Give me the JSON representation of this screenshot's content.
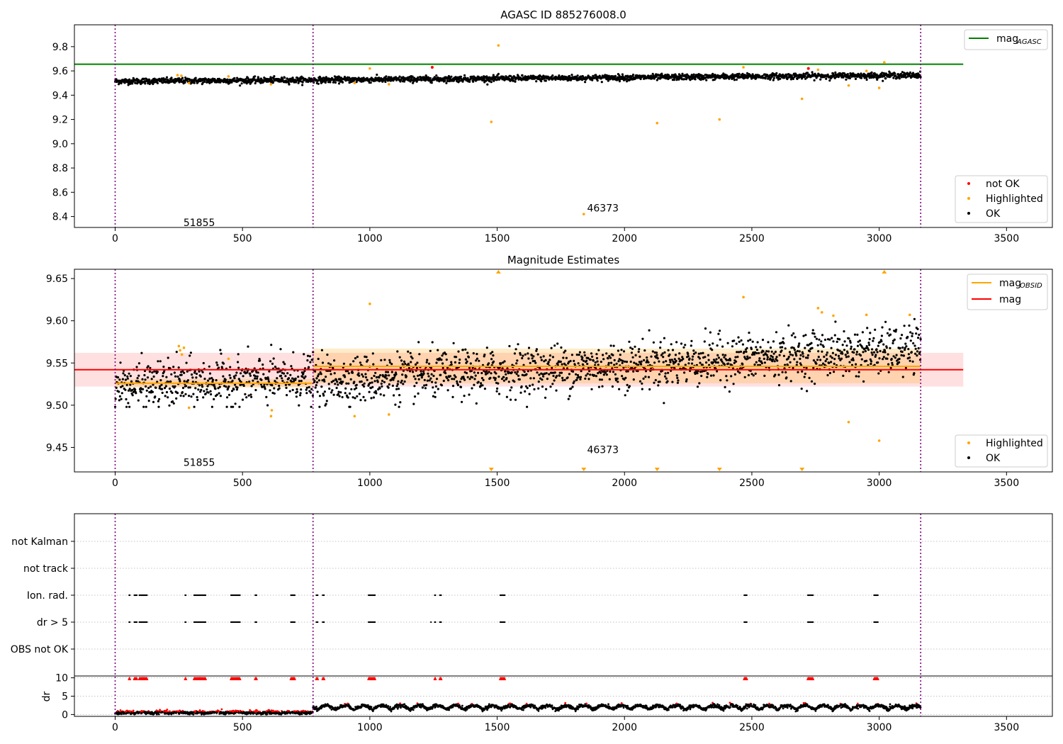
{
  "chart_data": [
    {
      "type": "scatter",
      "title": "AGASC ID 885276008.0",
      "xlabel": "",
      "ylabel": "",
      "xlim": [
        -160,
        3680
      ],
      "ylim": [
        8.31,
        9.98
      ],
      "xticks": [
        "0",
        "500",
        "1000",
        "1500",
        "2000",
        "2500",
        "3000",
        "3500"
      ],
      "yticks": [
        "8.4",
        "8.6",
        "8.8",
        "9.0",
        "9.2",
        "9.4",
        "9.6",
        "9.8"
      ],
      "vlines": [
        0,
        777,
        3163
      ],
      "annotations": [
        {
          "text": "51855",
          "x": 385,
          "y": 8.35
        },
        {
          "text": "46373",
          "x": 1970,
          "y": 8.47
        }
      ],
      "hlines": [
        {
          "name": "mag_AGASC",
          "y": 9.655,
          "x": [
            -160,
            3330
          ],
          "color": "#008000"
        }
      ],
      "ok_band": {
        "x0": 0,
        "x1": 3163,
        "segments": [
          {
            "x0": 0,
            "x1": 777,
            "m0": 9.515,
            "m1": 9.525
          },
          {
            "x0": 777,
            "x1": 3163,
            "m0": 9.525,
            "m1": 9.565
          }
        ],
        "scatter": 0.012
      },
      "highlighted": [
        {
          "x": 245,
          "y": 9.565
        },
        {
          "x": 260,
          "y": 9.56
        },
        {
          "x": 290,
          "y": 9.5
        },
        {
          "x": 445,
          "y": 9.555
        },
        {
          "x": 612,
          "y": 9.49
        },
        {
          "x": 940,
          "y": 9.5
        },
        {
          "x": 1000,
          "y": 9.62
        },
        {
          "x": 1075,
          "y": 9.49
        },
        {
          "x": 1477,
          "y": 9.18
        },
        {
          "x": 1505,
          "y": 9.81
        },
        {
          "x": 1840,
          "y": 8.42
        },
        {
          "x": 2128,
          "y": 9.17
        },
        {
          "x": 2373,
          "y": 9.2
        },
        {
          "x": 2467,
          "y": 9.63
        },
        {
          "x": 2697,
          "y": 9.37
        },
        {
          "x": 2760,
          "y": 9.61
        },
        {
          "x": 2880,
          "y": 9.48
        },
        {
          "x": 2950,
          "y": 9.6
        },
        {
          "x": 3000,
          "y": 9.46
        },
        {
          "x": 3020,
          "y": 9.67
        }
      ],
      "not_ok": [
        {
          "x": 1245,
          "y": 9.63
        },
        {
          "x": 2722,
          "y": 9.62
        }
      ],
      "legend_top": {
        "position": "top-right",
        "entries": [
          {
            "label": "mag",
            "sub": "AGASC",
            "color": "#008000"
          }
        ]
      },
      "legend_bottom": {
        "position": "bottom-right",
        "entries": [
          {
            "label": "not OK",
            "color": "#ff0000"
          },
          {
            "label": "Highlighted",
            "color": "#ffa500"
          },
          {
            "label": "OK",
            "color": "#000000"
          }
        ]
      }
    },
    {
      "type": "scatter",
      "title": "Magnitude Estimates",
      "xlabel": "",
      "ylabel": "",
      "xlim": [
        -160,
        3680
      ],
      "ylim": [
        9.421,
        9.661
      ],
      "xticks": [
        "0",
        "500",
        "1000",
        "1500",
        "2000",
        "2500",
        "3000",
        "3500"
      ],
      "yticks": [
        "9.45",
        "9.50",
        "9.55",
        "9.60",
        "9.65"
      ],
      "vlines": [
        0,
        777,
        3163
      ],
      "annotations": [
        {
          "text": "51855",
          "x": 385,
          "y": 9.4325
        },
        {
          "text": "46373",
          "x": 1970,
          "y": 9.4475
        }
      ],
      "mag": {
        "y": 9.542,
        "band": [
          9.522,
          9.562
        ],
        "x": [
          -160,
          3330
        ],
        "color": "#ff0000"
      },
      "mag_obsid": [
        {
          "x": [
            0,
            777
          ],
          "y": 9.526,
          "band": [
            9.521,
            9.531
          ]
        },
        {
          "x": [
            777,
            3163
          ],
          "y": 9.546,
          "band": [
            9.526,
            9.567
          ]
        }
      ],
      "ok_scatter": 0.014,
      "highlighted": [
        {
          "x": 250,
          "y": 9.57
        },
        {
          "x": 255,
          "y": 9.565
        },
        {
          "x": 262,
          "y": 9.56
        },
        {
          "x": 270,
          "y": 9.568
        },
        {
          "x": 290,
          "y": 9.497
        },
        {
          "x": 445,
          "y": 9.555
        },
        {
          "x": 612,
          "y": 9.487
        },
        {
          "x": 615,
          "y": 9.494
        },
        {
          "x": 940,
          "y": 9.487
        },
        {
          "x": 1000,
          "y": 9.62
        },
        {
          "x": 1075,
          "y": 9.489
        },
        {
          "x": 2467,
          "y": 9.628
        },
        {
          "x": 2760,
          "y": 9.615
        },
        {
          "x": 2775,
          "y": 9.61
        },
        {
          "x": 2820,
          "y": 9.606
        },
        {
          "x": 2880,
          "y": 9.48
        },
        {
          "x": 2950,
          "y": 9.607
        },
        {
          "x": 3000,
          "y": 9.458
        },
        {
          "x": 3120,
          "y": 9.607
        }
      ],
      "offscale_up": [
        1505,
        3020
      ],
      "offscale_down": [
        1477,
        1840,
        2128,
        2373,
        2697
      ],
      "legend_top": {
        "position": "top-right",
        "entries": [
          {
            "label": "mag",
            "sub": "OBSID",
            "color": "#ffa500"
          },
          {
            "label": "mag",
            "sub": "",
            "color": "#ff0000"
          }
        ]
      },
      "legend_bottom": {
        "position": "bottom-right",
        "entries": [
          {
            "label": "Highlighted",
            "color": "#ffa500"
          },
          {
            "label": "OK",
            "color": "#000000"
          }
        ]
      }
    },
    {
      "type": "scatter",
      "title": "",
      "xlabel": "",
      "ylabel": "",
      "xlim": [
        -160,
        3680
      ],
      "ylim": [
        -0.5,
        5.5
      ],
      "xticks": [
        "0",
        "500",
        "1000",
        "1500",
        "2000",
        "2500",
        "3000",
        "3500"
      ],
      "flag_rows": [
        "not Kalman",
        "not track",
        "Ion. rad.",
        "dr > 5",
        "OBS not OK"
      ],
      "vlines": [
        0,
        777,
        3163
      ],
      "flag_clusters": [
        {
          "x0": 55,
          "x1": 58
        },
        {
          "x0": 75,
          "x1": 85
        },
        {
          "x0": 95,
          "x1": 125
        },
        {
          "x0": 275,
          "x1": 278
        },
        {
          "x0": 310,
          "x1": 355
        },
        {
          "x0": 455,
          "x1": 490
        },
        {
          "x0": 550,
          "x1": 557
        },
        {
          "x0": 690,
          "x1": 705
        },
        {
          "x0": 790,
          "x1": 795
        },
        {
          "x0": 815,
          "x1": 822
        },
        {
          "x0": 995,
          "x1": 1020
        },
        {
          "x0": 1255,
          "x1": 1258
        },
        {
          "x0": 1275,
          "x1": 1280
        },
        {
          "x0": 1512,
          "x1": 1530
        },
        {
          "x0": 2470,
          "x1": 2482
        },
        {
          "x0": 2720,
          "x1": 2740
        },
        {
          "x0": 2980,
          "x1": 2995
        }
      ],
      "extra_dr5": [
        1240
      ],
      "dr_sub": {
        "ylabel": "dr",
        "yticks": [
          "0",
          "5",
          "10"
        ],
        "ylim": [
          -0.5,
          10.5
        ],
        "segments": [
          {
            "x0": 0,
            "x1": 777,
            "base": 0.5,
            "amp": 0.3
          },
          {
            "x0": 777,
            "x1": 3163,
            "base": 1.9,
            "amp": 1.1
          }
        ]
      }
    }
  ]
}
